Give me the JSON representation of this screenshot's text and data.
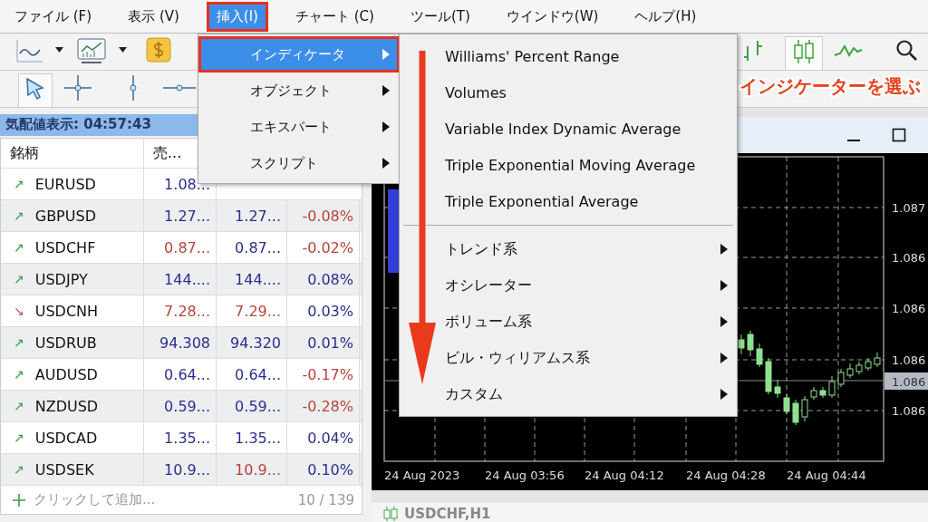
{
  "menu_bar": [
    {
      "label": "ファイル (F)",
      "selected": false,
      "highlighted": false
    },
    {
      "label": "表示 (V)",
      "selected": false,
      "highlighted": false
    },
    {
      "label": "挿入(I)",
      "selected": true,
      "highlighted": true
    },
    {
      "label": "チャート (C)",
      "selected": false,
      "highlighted": false
    },
    {
      "label": "ツール(T)",
      "selected": false,
      "highlighted": false
    },
    {
      "label": "ウインドウ(W)",
      "selected": false,
      "highlighted": false
    },
    {
      "label": "ヘルプ(H)",
      "selected": false,
      "highlighted": false
    }
  ],
  "market_watch": {
    "title": "気配値表示: 04:57:43",
    "columns": [
      "銘柄",
      "売..."
    ],
    "rows": [
      {
        "symbol": "EURUSD",
        "arrow": "↗",
        "kind": "up",
        "cells": [
          {
            "text": "1.08...",
            "color": "#28308c"
          }
        ]
      },
      {
        "symbol": "GBPUSD",
        "arrow": "↗",
        "kind": "up",
        "cells": [
          {
            "text": "1.27...",
            "color": "#28308c"
          },
          {
            "text": "1.27...",
            "color": "#28308c"
          },
          {
            "text": "-0.08%",
            "color": "#b8433a"
          }
        ]
      },
      {
        "symbol": "USDCHF",
        "arrow": "↗",
        "kind": "up",
        "cells": [
          {
            "text": "0.87...",
            "color": "#b8433a"
          },
          {
            "text": "0.87...",
            "color": "#28308c"
          },
          {
            "text": "-0.02%",
            "color": "#b8433a"
          }
        ]
      },
      {
        "symbol": "USDJPY",
        "arrow": "↗",
        "kind": "up",
        "cells": [
          {
            "text": "144....",
            "color": "#28308c"
          },
          {
            "text": "144....",
            "color": "#28308c"
          },
          {
            "text": "0.08%",
            "color": "#28308c"
          }
        ]
      },
      {
        "symbol": "USDCNH",
        "arrow": "↘",
        "kind": "down",
        "cells": [
          {
            "text": "7.28...",
            "color": "#b8433a"
          },
          {
            "text": "7.29...",
            "color": "#b8433a"
          },
          {
            "text": "0.03%",
            "color": "#28308c"
          }
        ]
      },
      {
        "symbol": "USDRUB",
        "arrow": "↗",
        "kind": "up",
        "cells": [
          {
            "text": "94.308",
            "color": "#28308c"
          },
          {
            "text": "94.320",
            "color": "#28308c"
          },
          {
            "text": "0.01%",
            "color": "#28308c"
          }
        ]
      },
      {
        "symbol": "AUDUSD",
        "arrow": "↗",
        "kind": "up",
        "cells": [
          {
            "text": "0.64...",
            "color": "#28308c"
          },
          {
            "text": "0.64...",
            "color": "#28308c"
          },
          {
            "text": "-0.17%",
            "color": "#b8433a"
          }
        ]
      },
      {
        "symbol": "NZDUSD",
        "arrow": "↗",
        "kind": "up",
        "cells": [
          {
            "text": "0.59...",
            "color": "#28308c"
          },
          {
            "text": "0.59...",
            "color": "#28308c"
          },
          {
            "text": "-0.28%",
            "color": "#b8433a"
          }
        ]
      },
      {
        "symbol": "USDCAD",
        "arrow": "↗",
        "kind": "up",
        "cells": [
          {
            "text": "1.35...",
            "color": "#28308c"
          },
          {
            "text": "1.35...",
            "color": "#28308c"
          },
          {
            "text": "0.04%",
            "color": "#28308c"
          }
        ]
      },
      {
        "symbol": "USDSEK",
        "arrow": "↗",
        "kind": "up",
        "cells": [
          {
            "text": "10.9...",
            "color": "#28308c"
          },
          {
            "text": "10.9...",
            "color": "#b8433a"
          },
          {
            "text": "0.10%",
            "color": "#28308c"
          }
        ]
      }
    ],
    "add_label": "クリックして追加...",
    "count": "10 / 139"
  },
  "insert_menu": [
    {
      "label": "インディケータ",
      "selected": true,
      "highlighted": true
    },
    {
      "label": "オブジェクト",
      "selected": false,
      "highlighted": false
    },
    {
      "label": "エキスパート",
      "selected": false,
      "highlighted": false
    },
    {
      "label": "スクリプト",
      "selected": false,
      "highlighted": false
    }
  ],
  "indicator_submenu": [
    {
      "kind": "item",
      "label": "Williams' Percent Range"
    },
    {
      "kind": "item",
      "label": "Volumes"
    },
    {
      "kind": "item",
      "label": "Variable Index Dynamic Average"
    },
    {
      "kind": "item",
      "label": "Triple Exponential Moving Average"
    },
    {
      "kind": "item",
      "label": "Triple Exponential Average"
    },
    {
      "kind": "separator"
    },
    {
      "kind": "submenu",
      "label": "トレンド系"
    },
    {
      "kind": "submenu",
      "label": "オシレーター"
    },
    {
      "kind": "submenu",
      "label": "ボリューム系"
    },
    {
      "kind": "submenu",
      "label": "ビル・ウィリアムス系"
    },
    {
      "kind": "submenu",
      "label": "カスタム"
    }
  ],
  "annotation": {
    "text": "インジケーターを選ぶ"
  },
  "chart": {
    "y_labels": [
      "1.087",
      "1.086",
      "1.086",
      "1.086",
      "1.086"
    ],
    "current_price": "1.086",
    "x_labels": [
      "24 Aug 2023",
      "24 Aug 03:56",
      "24 Aug 04:12",
      "24 Aug 04:28",
      "24 Aug 04:44"
    ]
  },
  "bottom_window": {
    "title": "USDCHF,H1"
  }
}
